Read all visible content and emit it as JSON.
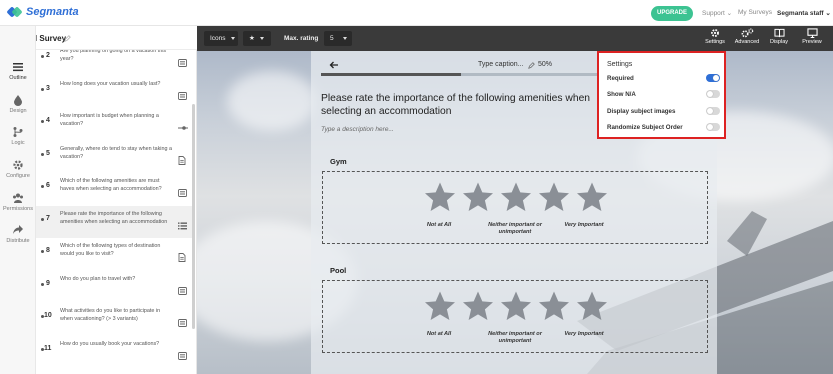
{
  "app": {
    "logo_text": "Segmanta",
    "upgrade_label": "UPGRADE",
    "support_label": "Support",
    "my_surveys_label": "My Surveys",
    "user_label": "Segmanta staff",
    "brand_color": "#2f6fd6",
    "upgrade_color": "#3cc392"
  },
  "survey": {
    "title": "Travel Survey"
  },
  "leftnav": [
    {
      "label": "Outline",
      "icon": "list-icon"
    },
    {
      "label": "Design",
      "icon": "drop-icon"
    },
    {
      "label": "Logic",
      "icon": "branch-icon"
    },
    {
      "label": "Configure",
      "icon": "gear-icon"
    },
    {
      "label": "Permissions",
      "icon": "people-icon"
    },
    {
      "label": "Distribute",
      "icon": "share-icon"
    }
  ],
  "questions": [
    {
      "num": "2",
      "text": "Are you planning on going on a vacation this year?",
      "icon": "choice-icon"
    },
    {
      "num": "3",
      "text": "How long does your vacation usually last?",
      "icon": "choice-icon"
    },
    {
      "num": "4",
      "text": "How important is budget when planning a vacation?",
      "icon": "slider-icon"
    },
    {
      "num": "5",
      "text": "Generally, where do tend to stay when taking a vacation?",
      "icon": "doc-icon"
    },
    {
      "num": "6",
      "text": "Which of the following amenities are must haves when selecting an accommodation?",
      "icon": "choice-icon"
    },
    {
      "num": "7",
      "text": "Please rate the importance of the following amenities when selecting an accommodation",
      "icon": "list-rate-icon"
    },
    {
      "num": "8",
      "text": "Which of the following types of destination would you like to visit?",
      "icon": "doc-icon"
    },
    {
      "num": "9",
      "text": "Who do you plan to travel with?",
      "icon": "choice-icon"
    },
    {
      "num": "10",
      "text": "What activities do you like to participate in when vacationing? (> 3 variants)",
      "icon": "choice-icon"
    },
    {
      "num": "11",
      "text": "How do you usually book your vacations?",
      "icon": "choice-icon"
    }
  ],
  "toolbar": {
    "icons_label": "Icons",
    "max_rating_label": "Max. rating",
    "max_rating_value": "5",
    "tools": [
      {
        "label": "Settings",
        "icon": "gear-icon"
      },
      {
        "label": "Advanced",
        "icon": "gears-icon"
      },
      {
        "label": "Display",
        "icon": "book-icon"
      },
      {
        "label": "Preview",
        "icon": "monitor-icon"
      }
    ]
  },
  "preview": {
    "caption_placeholder": "Type caption...",
    "percent": "50%",
    "progress": 0.5,
    "question_text": "Please rate the importance of the following amenities when selecting an accommodation",
    "description_placeholder": "Type a description here...",
    "subjects": [
      {
        "name": "Gym",
        "labels": [
          "Not at All",
          "Neither important or unimportant",
          "Very Important"
        ]
      },
      {
        "name": "Pool",
        "labels": [
          "Not at All",
          "Neither important or unimportant",
          "Very Important"
        ]
      }
    ],
    "star_count": 5
  },
  "settings": {
    "title": "Settings",
    "options": [
      {
        "label": "Required",
        "on": true
      },
      {
        "label": "Show N/A",
        "on": false
      },
      {
        "label": "Display subject images",
        "on": false
      },
      {
        "label": "Randomize Subject Order",
        "on": false
      }
    ]
  }
}
